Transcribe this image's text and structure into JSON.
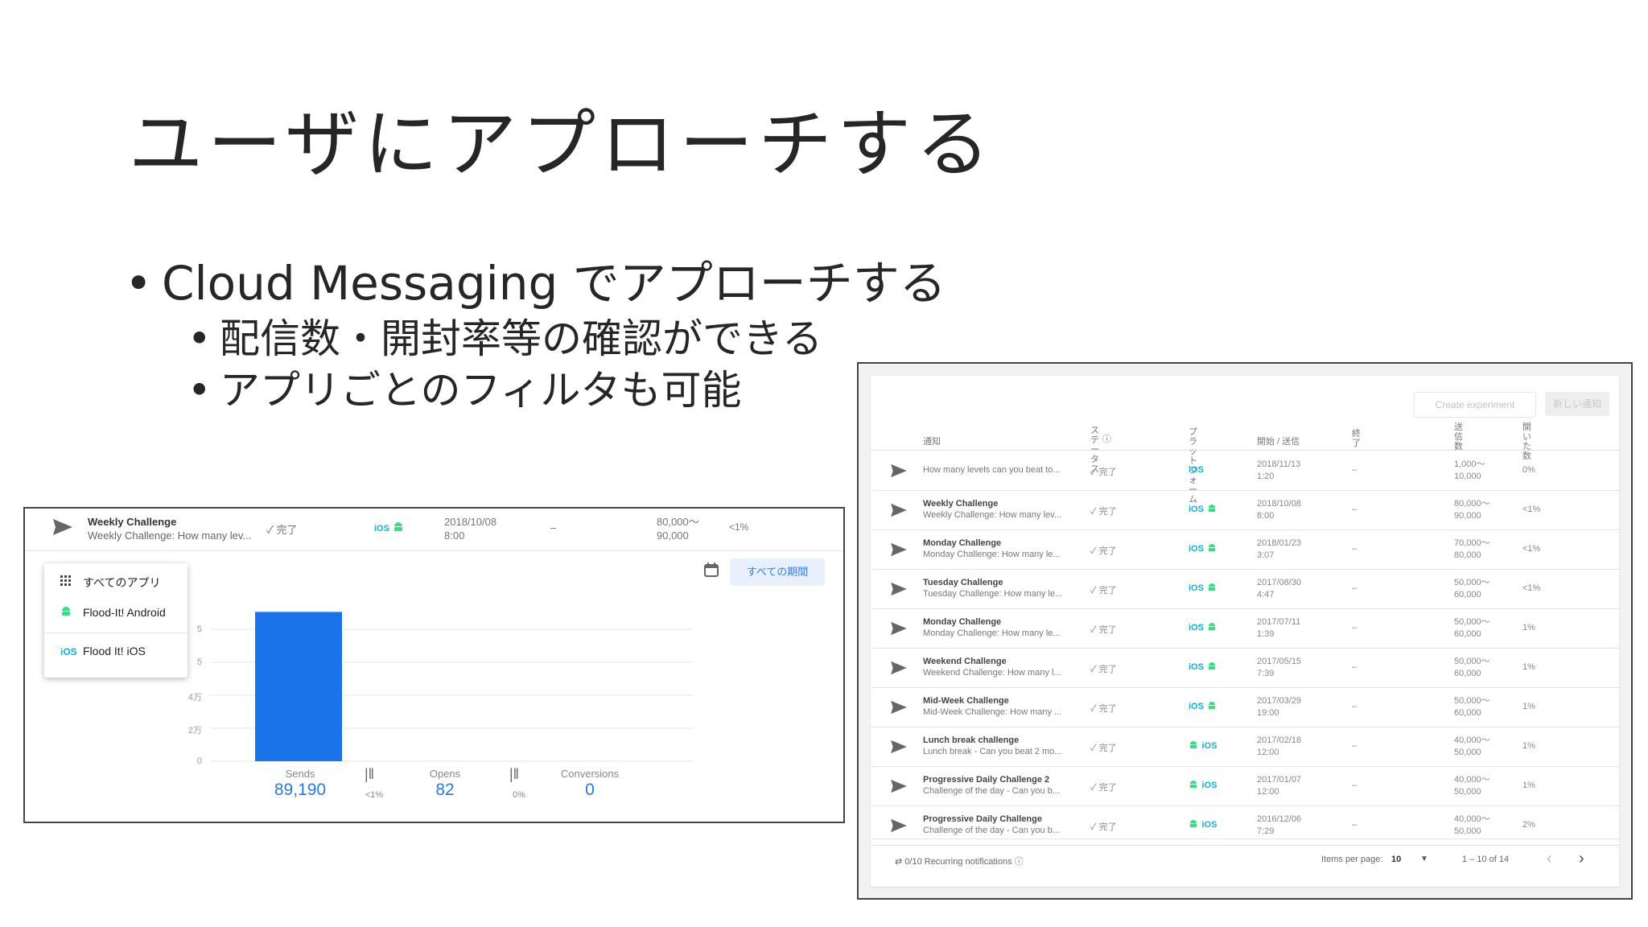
{
  "slide": {
    "title": "ユーザにアプローチする",
    "bullet_main": "Cloud Messaging でアプローチする",
    "sub_bullets": [
      "配信数・開封率等の確認ができる",
      "アプリごとのフィルタも可能"
    ]
  },
  "left_panel": {
    "row": {
      "name": "Weekly Challenge",
      "desc": "Weekly Challenge: How many lev...",
      "status": "完了",
      "platform": "iOS",
      "date_line1": "2018/10/08",
      "date_line2": "8:00",
      "end": "–",
      "sent_line1": "80,000～",
      "sent_line2": "90,000",
      "rate": "<1%"
    },
    "app_menu": {
      "all_apps": "すべてのアプリ",
      "android_app": "Flood-It! Android",
      "ios_app": "Flood It! iOS",
      "ios_label": "iOS"
    },
    "period_button": "すべての期間",
    "y_ticks": [
      "5",
      "5",
      "4万",
      "2万",
      "0"
    ],
    "metrics": {
      "sends_label": "Sends",
      "sends_value": "89,190",
      "opens_label": "Opens",
      "opens_value": "82",
      "conversions_label": "Conversions",
      "conversions_value": "0",
      "rate1": "<1%",
      "rate2": "0%"
    }
  },
  "chart_data": {
    "type": "bar",
    "categories": [
      "Sends"
    ],
    "values": [
      89190
    ],
    "ylim": [
      0,
      100000
    ],
    "color": "#1a73e8"
  },
  "right_panel": {
    "buttons": {
      "create_experiment": "Create experiment",
      "new_notification": "新しい通知"
    },
    "headers": {
      "notification": "通知",
      "status": "ステータス",
      "platform": "プラットフォーム",
      "start_send": "開始 / 送信",
      "end": "終了",
      "sent": "送信数",
      "opened": "開いた数"
    },
    "rows": [
      {
        "name": "",
        "desc": "How many levels can you beat to...",
        "status": "完了",
        "platforms": [
          "ios"
        ],
        "d1": "2018/11/13",
        "d2": "1:20",
        "end": "–",
        "s1": "1,000～",
        "s2": "10,000",
        "rate": "0%"
      },
      {
        "name": "Weekly Challenge",
        "desc": "Weekly Challenge: How many lev...",
        "status": "完了",
        "platforms": [
          "ios",
          "android"
        ],
        "d1": "2018/10/08",
        "d2": "8:00",
        "end": "–",
        "s1": "80,000～",
        "s2": "90,000",
        "rate": "<1%"
      },
      {
        "name": "Monday Challenge",
        "desc": "Monday Challenge: How many le...",
        "status": "完了",
        "platforms": [
          "ios",
          "android"
        ],
        "d1": "2018/01/23",
        "d2": "3:07",
        "end": "–",
        "s1": "70,000～",
        "s2": "80,000",
        "rate": "<1%"
      },
      {
        "name": "Tuesday Challenge",
        "desc": "Tuesday Challenge: How many le...",
        "status": "完了",
        "platforms": [
          "ios",
          "android"
        ],
        "d1": "2017/08/30",
        "d2": "4:47",
        "end": "–",
        "s1": "50,000～",
        "s2": "60,000",
        "rate": "<1%"
      },
      {
        "name": "Monday Challenge",
        "desc": "Monday Challenge: How many le...",
        "status": "完了",
        "platforms": [
          "ios",
          "android"
        ],
        "d1": "2017/07/11",
        "d2": "1:39",
        "end": "–",
        "s1": "50,000～",
        "s2": "60,000",
        "rate": "1%"
      },
      {
        "name": "Weekend Challenge",
        "desc": "Weekend Challenge: How many l...",
        "status": "完了",
        "platforms": [
          "ios",
          "android"
        ],
        "d1": "2017/05/15",
        "d2": "7:39",
        "end": "–",
        "s1": "50,000～",
        "s2": "60,000",
        "rate": "1%"
      },
      {
        "name": "Mid-Week Challenge",
        "desc": "Mid-Week Challenge: How many ...",
        "status": "完了",
        "platforms": [
          "ios",
          "android"
        ],
        "d1": "2017/03/29",
        "d2": "19:00",
        "end": "–",
        "s1": "50,000～",
        "s2": "60,000",
        "rate": "1%"
      },
      {
        "name": "Lunch break challenge",
        "desc": "Lunch break - Can you beat 2 mo...",
        "status": "完了",
        "platforms": [
          "android",
          "ios"
        ],
        "d1": "2017/02/18",
        "d2": "12:00",
        "end": "–",
        "s1": "40,000～",
        "s2": "50,000",
        "rate": "1%"
      },
      {
        "name": "Progressive Daily Challenge 2",
        "desc": "Challenge of the day - Can you b...",
        "status": "完了",
        "platforms": [
          "android",
          "ios"
        ],
        "d1": "2017/01/07",
        "d2": "12:00",
        "end": "–",
        "s1": "40,000～",
        "s2": "50,000",
        "rate": "1%"
      },
      {
        "name": "Progressive Daily Challenge",
        "desc": "Challenge of the day - Can you b...",
        "status": "完了",
        "platforms": [
          "android",
          "ios"
        ],
        "d1": "2016/12/06",
        "d2": "7:29",
        "end": "–",
        "s1": "40,000～",
        "s2": "50,000",
        "rate": "2%"
      }
    ],
    "footer": {
      "recurring": "0/10 Recurring notifications",
      "items_per_page_label": "Items per page:",
      "items_per_page_value": "10",
      "range": "1 – 10 of 14"
    }
  }
}
